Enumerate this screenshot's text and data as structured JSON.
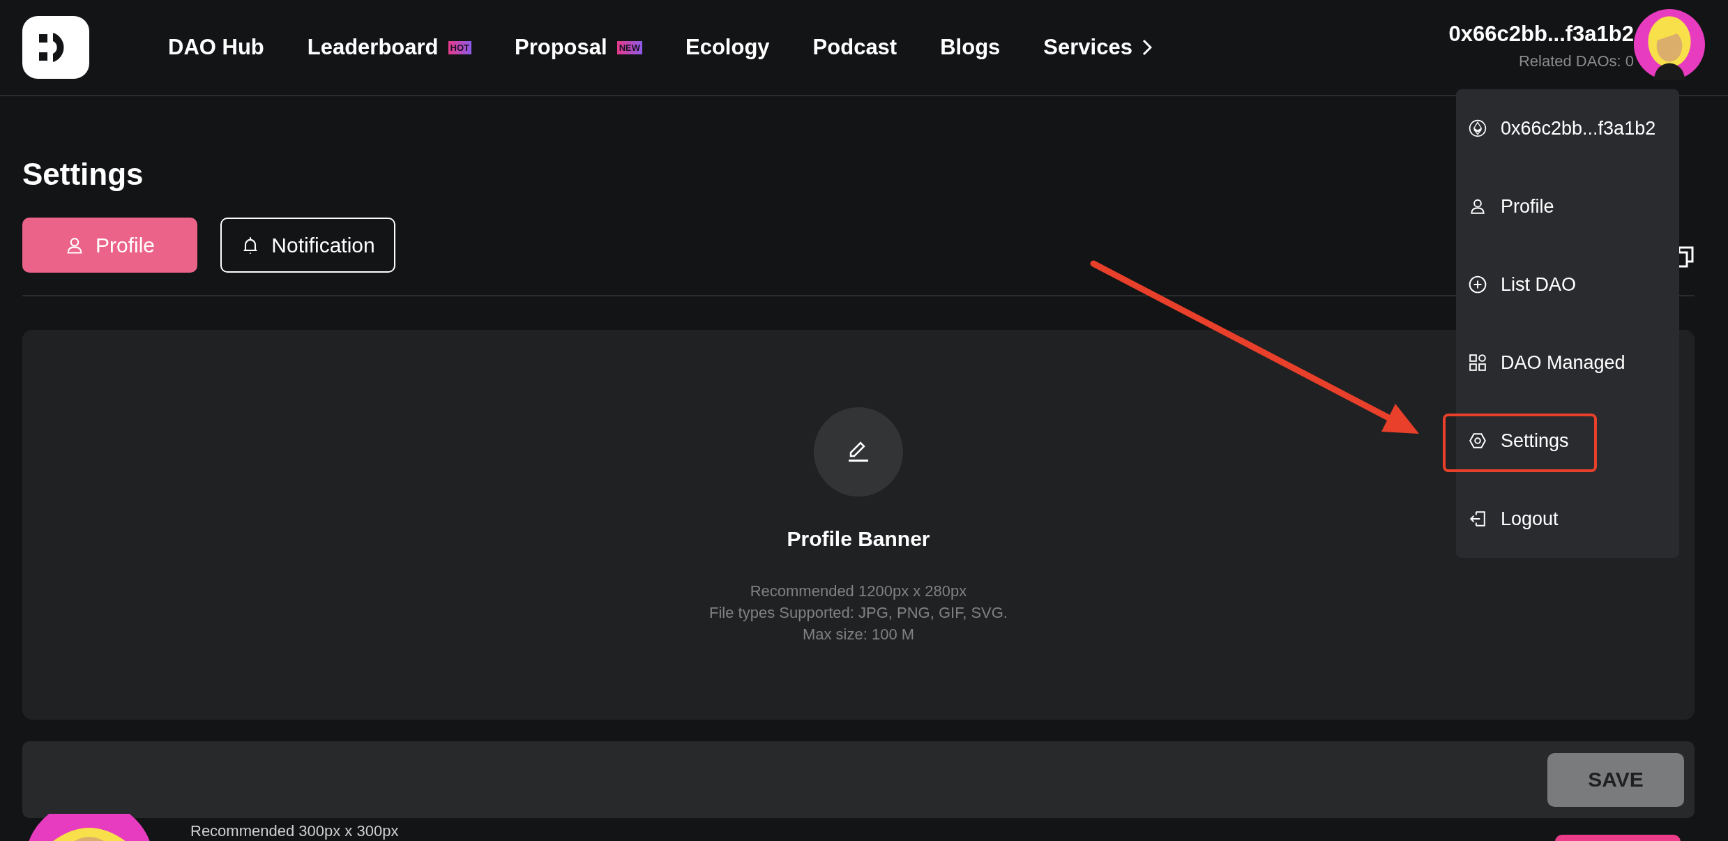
{
  "nav": [
    {
      "label": "DAO Hub"
    },
    {
      "label": "Leaderboard",
      "badge": "HOT"
    },
    {
      "label": "Proposal",
      "badge": "NEW"
    },
    {
      "label": "Ecology"
    },
    {
      "label": "Podcast"
    },
    {
      "label": "Blogs"
    },
    {
      "label": "Services",
      "chevron": true
    }
  ],
  "account": {
    "address": "0x66c2bb...f3a1b2",
    "related": "Related DAOs: 0"
  },
  "page": {
    "title": "Settings"
  },
  "tabs": [
    {
      "label": "Profile",
      "kind": "user",
      "selected": true
    },
    {
      "label": "Notification",
      "kind": "bell",
      "selected": false
    }
  ],
  "banner": {
    "title": "Profile Banner",
    "notes": [
      "Recommended 1200px x 280px",
      "File types Supported: JPG, PNG, GIF, SVG.",
      "Max size: 100 M"
    ]
  },
  "save_button": "SAVE",
  "avatar_section": {
    "note": "Recommended 300px x 300px"
  },
  "menu": [
    {
      "label": "0x66c2bb...f3a1b2",
      "kind": "ethereum",
      "highlighted": false
    },
    {
      "label": "Profile",
      "kind": "user",
      "highlighted": false
    },
    {
      "label": "List DAO",
      "kind": "plus",
      "highlighted": false
    },
    {
      "label": "DAO Managed",
      "kind": "grid",
      "highlighted": false
    },
    {
      "label": "Settings",
      "kind": "settings",
      "highlighted": true
    },
    {
      "label": "Logout",
      "kind": "logout",
      "highlighted": false
    }
  ]
}
